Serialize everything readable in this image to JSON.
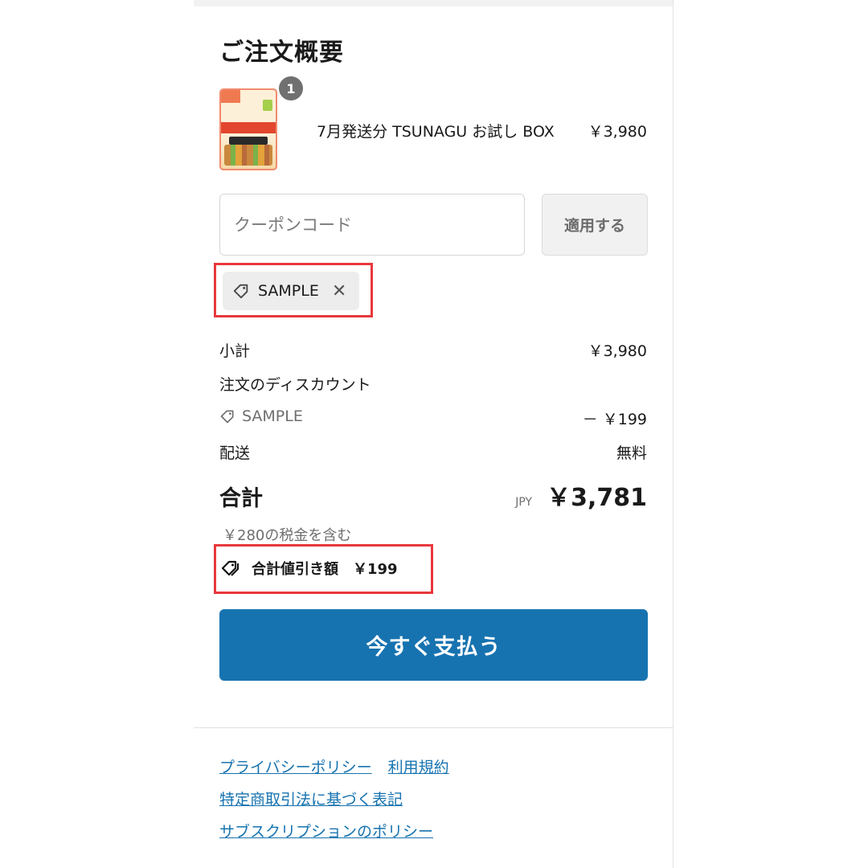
{
  "summary": {
    "title": "ご注文概要",
    "product": {
      "quantity": "1",
      "name": "7月発送分 TSUNAGU お試し BOX",
      "price": "￥3,980",
      "image_icon": "product-box-image"
    },
    "coupon": {
      "placeholder": "クーポンコード",
      "apply_label": "適用する",
      "applied_code": "SAMPLE",
      "remove_icon": "close-icon"
    },
    "subtotal": {
      "label": "小計",
      "value": "￥3,980"
    },
    "discount": {
      "label": "注文のディスカウント",
      "code": "SAMPLE",
      "value": "－ ￥199"
    },
    "shipping": {
      "label": "配送",
      "value": "無料"
    },
    "total": {
      "label": "合計",
      "currency": "JPY",
      "value": "￥3,781"
    },
    "tax_note": "￥280の税金を含む",
    "savings": {
      "label": "合計値引き額",
      "value": "￥199"
    },
    "pay_button": "今すぐ支払う"
  },
  "footer": {
    "links": [
      "プライバシーポリシー",
      "利用規約",
      "特定商取引法に基づく表記",
      "サブスクリプションのポリシー"
    ]
  },
  "colors": {
    "primary": "#1773b0",
    "highlight": "#e8383d",
    "chip_bg": "#ededed"
  }
}
